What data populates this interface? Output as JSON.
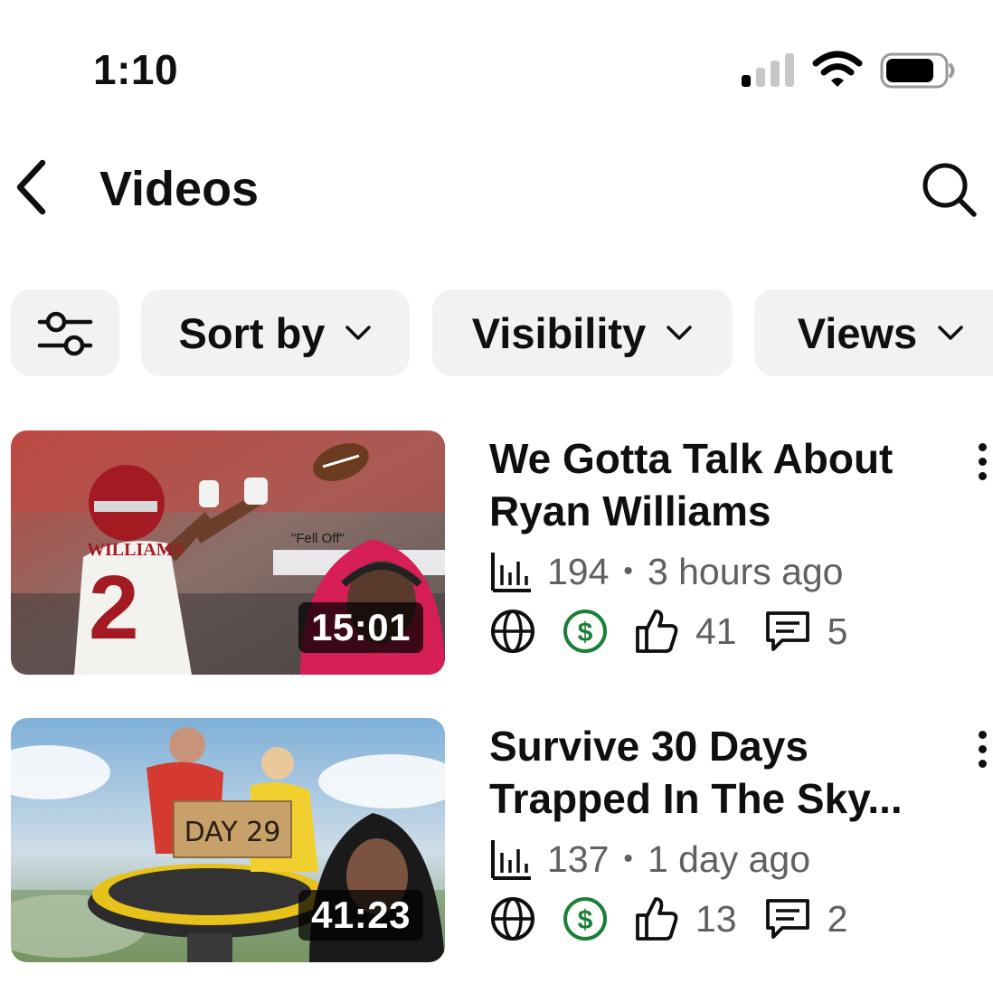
{
  "status_bar": {
    "time": "1:10"
  },
  "header": {
    "title": "Videos"
  },
  "filters": {
    "sort_label": "Sort by",
    "visibility_label": "Visibility",
    "views_label": "Views"
  },
  "videos": [
    {
      "title": "We Gotta Talk About Ryan Williams",
      "duration": "15:01",
      "views": "194",
      "age": "3 hours ago",
      "likes": "41",
      "comments": "5",
      "thumb_caption": "\"Fell Off\"",
      "jersey_name": "WILLIAMS",
      "jersey_number": "2"
    },
    {
      "title": "Survive 30 Days Trapped In The Sky...",
      "duration": "41:23",
      "views": "137",
      "age": "1 day ago",
      "likes": "13",
      "comments": "2",
      "sign_text": "DAY 29"
    }
  ],
  "colors": {
    "monetization": "#1a7f37",
    "meta_gray": "#606060",
    "chip_bg": "#f2f2f2"
  },
  "icons": [
    "signal-icon",
    "wifi-icon",
    "battery-icon",
    "back-arrow-icon",
    "search-icon",
    "filter-sliders-icon",
    "chevron-down-icon",
    "views-chart-icon",
    "globe-icon",
    "dollar-icon",
    "thumbs-up-icon",
    "comment-icon",
    "more-vert-icon"
  ]
}
